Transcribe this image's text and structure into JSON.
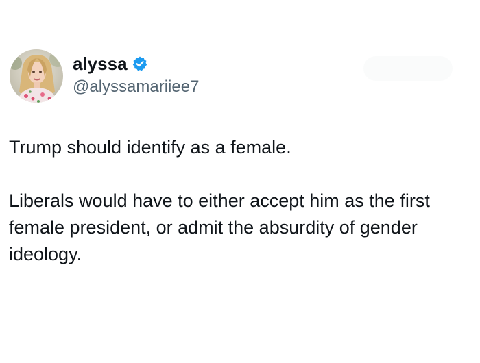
{
  "tweet": {
    "author": {
      "display_name": "alyssa",
      "handle": "@alyssamariiee7",
      "verified": true,
      "verified_badge_color": "#1d9bf0"
    },
    "body": {
      "line1": "Trump should identify as a female.",
      "line2": "Liberals would have to either accept him as the first female president, or admit the absurdity of gender ideology."
    }
  },
  "colors": {
    "text_primary": "#0f1419",
    "text_secondary": "#536471",
    "background": "#ffffff"
  },
  "icons": {
    "verified": "verified-badge-icon"
  }
}
